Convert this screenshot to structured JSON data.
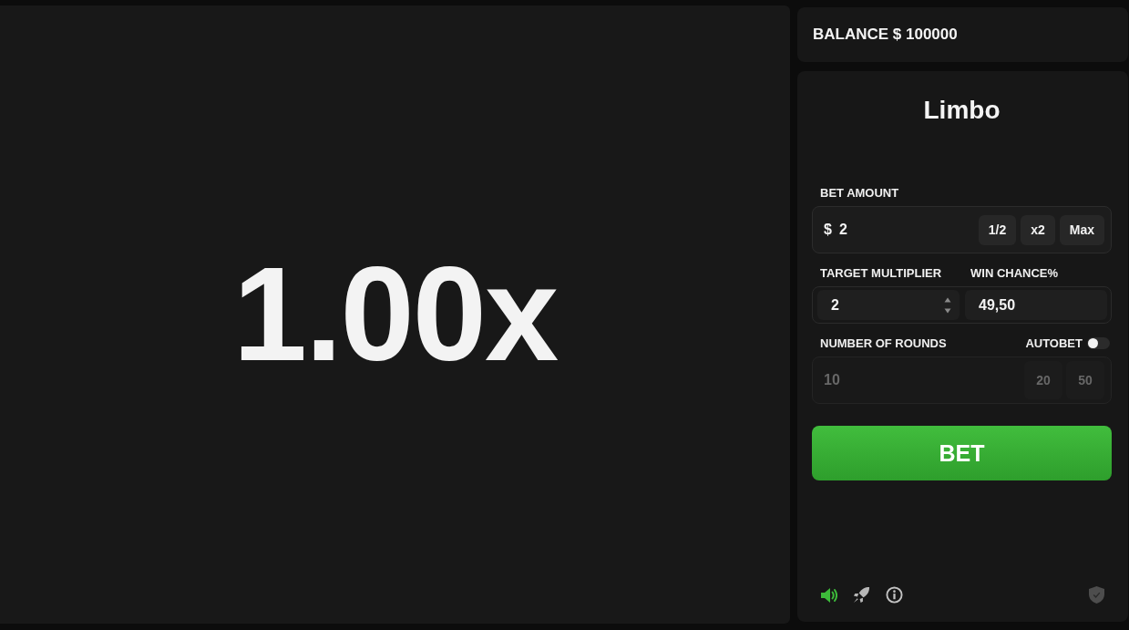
{
  "stage": {
    "multiplier": "1.00x"
  },
  "balance": {
    "text": "BALANCE $ 100000"
  },
  "panel": {
    "title": "Limbo",
    "bet_amount": {
      "label": "BET AMOUNT",
      "currency": "$",
      "value": "2",
      "buttons": [
        "1/2",
        "x2",
        "Max"
      ]
    },
    "target_multiplier": {
      "label": "TARGET MULTIPLIER",
      "value": "2"
    },
    "win_chance": {
      "label": "WIN CHANCE%",
      "value": "49,50"
    },
    "rounds": {
      "label": "NUMBER OF ROUNDS",
      "value": "10",
      "presets": [
        "20",
        "50"
      ],
      "disabled": true
    },
    "autobet": {
      "label": "AUTOBET",
      "on": false
    },
    "bet_button": {
      "label": "BET"
    },
    "footer": {
      "icons": [
        {
          "kind": "sound",
          "on": true
        },
        {
          "kind": "rocket",
          "on": false
        },
        {
          "kind": "info",
          "on": false
        },
        {
          "kind": "shield",
          "on": false
        }
      ]
    }
  }
}
